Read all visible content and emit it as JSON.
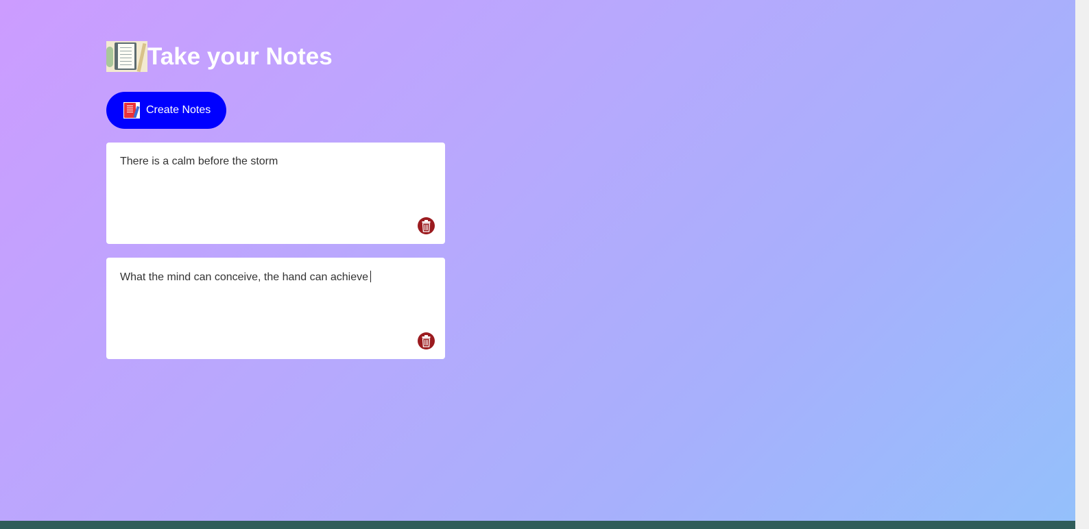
{
  "app": {
    "title": "Take your Notes",
    "logo_icon": "notebook-icon"
  },
  "actions": {
    "create_label": "Create Notes",
    "create_icon": "notebook-pen-icon"
  },
  "notes": [
    {
      "text": "There is a calm before the storm",
      "delete_icon": "trash-icon",
      "focused": false
    },
    {
      "text": "What the mind can conceive, the hand can achieve",
      "delete_icon": "trash-icon",
      "focused": true
    }
  ],
  "colors": {
    "create_button": "#0000ff",
    "delete_button": "#9b1b1f",
    "background_start": "#cc9cff",
    "background_end": "#94c0fb"
  }
}
